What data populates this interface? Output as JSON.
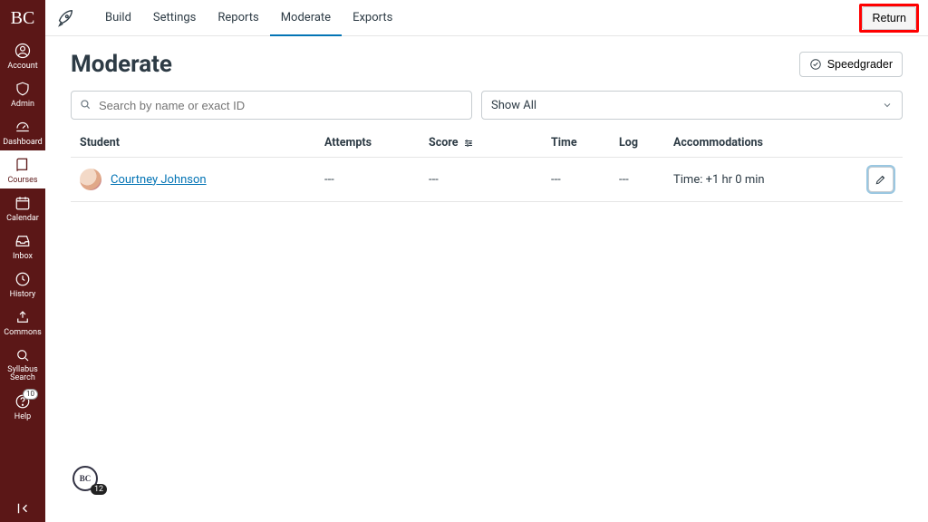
{
  "logo": "BC",
  "sidebar": {
    "items": [
      {
        "label": "Account"
      },
      {
        "label": "Admin"
      },
      {
        "label": "Dashboard"
      },
      {
        "label": "Courses"
      },
      {
        "label": "Calendar"
      },
      {
        "label": "Inbox"
      },
      {
        "label": "History"
      },
      {
        "label": "Commons"
      },
      {
        "label": "Syllabus Search"
      },
      {
        "label": "Help",
        "badge": "10"
      }
    ]
  },
  "topbar": {
    "tabs": [
      {
        "label": "Build"
      },
      {
        "label": "Settings"
      },
      {
        "label": "Reports"
      },
      {
        "label": "Moderate"
      },
      {
        "label": "Exports"
      }
    ],
    "return_label": "Return"
  },
  "page": {
    "title": "Moderate",
    "speedgrader_label": "Speedgrader"
  },
  "filters": {
    "search_placeholder": "Search by name or exact ID",
    "showall_label": "Show All"
  },
  "columns": {
    "student": "Student",
    "attempts": "Attempts",
    "score": "Score",
    "time": "Time",
    "log": "Log",
    "accommodations": "Accommodations"
  },
  "rows": [
    {
      "name": "Courtney Johnson",
      "attempts": "---",
      "score": "---",
      "time": "---",
      "log": "---",
      "accommodations": "Time: +1 hr 0 min"
    }
  ],
  "floating": {
    "label": "BC",
    "badge": "12"
  }
}
